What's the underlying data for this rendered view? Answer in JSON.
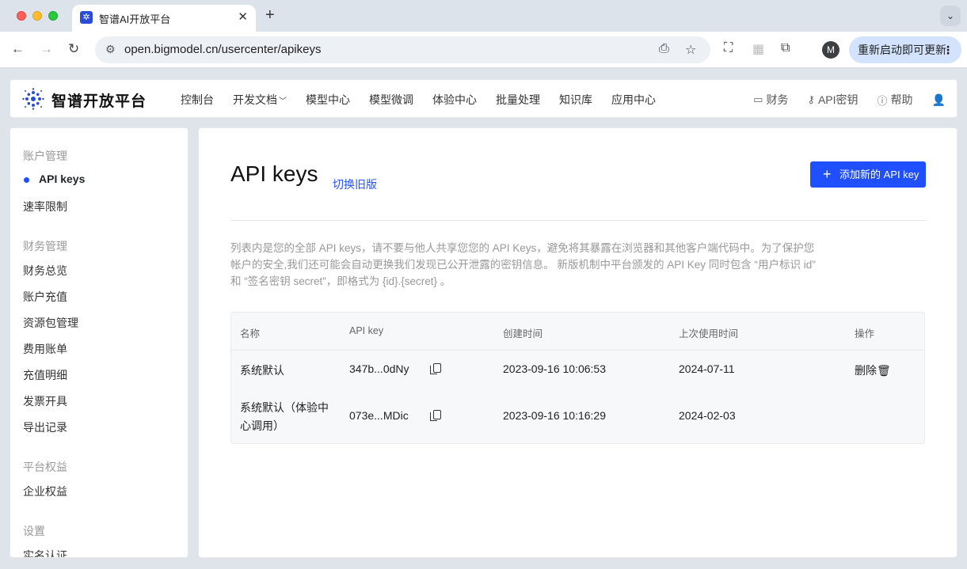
{
  "browser": {
    "tab_title": "智谱AI开放平台",
    "tab_close": "✕",
    "new_tab": "+",
    "url": "open.bigmodel.cn/usercenter/apikeys",
    "profile_initial": "M",
    "update_button": "重新启动即可更新"
  },
  "header": {
    "logo_text": "智谱开放平台",
    "nav": [
      "控制台",
      "开发文档",
      "模型中心",
      "模型微调",
      "体验中心",
      "批量处理",
      "知识库",
      "应用中心"
    ],
    "finance": "财务",
    "api_keys": "API密钥",
    "help": "帮助"
  },
  "sidebar": {
    "groups": [
      {
        "title": "账户管理",
        "items": [
          "API keys",
          "速率限制"
        ]
      },
      {
        "title": "财务管理",
        "items": [
          "财务总览",
          "账户充值",
          "资源包管理",
          "费用账单",
          "充值明细",
          "发票开具",
          "导出记录"
        ]
      },
      {
        "title": "平台权益",
        "items": [
          "企业权益"
        ]
      },
      {
        "title": "设置",
        "items": [
          "实名认证"
        ]
      }
    ],
    "active": "API keys"
  },
  "main": {
    "title": "API keys",
    "switch_link": "切换旧版",
    "add_button": "添加新的 API key",
    "description": "列表内是您的全部 API keys，请不要与他人共享您您的 API Keys，避免将其暴露在浏览器和其他客户端代码中。为了保护您帐户的安全,我们还可能会自动更换我们发现已公开泄露的密钥信息。 新版机制中平台颁发的 API Key 同时包含 “用户标识 id” 和 “签名密钥 secret”，即格式为 {id}.{secret} 。",
    "table": {
      "headers": [
        "名称",
        "API key",
        "创建时间",
        "上次使用时间",
        "操作"
      ],
      "rows": [
        {
          "name": "系统默认",
          "key": "347b...0dNy",
          "created": "2023-09-16 10:06:53",
          "last_used": "2024-07-11",
          "action": "删除"
        },
        {
          "name_line1": "系统默认（体验中",
          "name_line2": "心调用）",
          "key": "073e...MDic",
          "created": "2023-09-16 10:16:29",
          "last_used": "2024-02-03",
          "action": ""
        }
      ]
    }
  }
}
